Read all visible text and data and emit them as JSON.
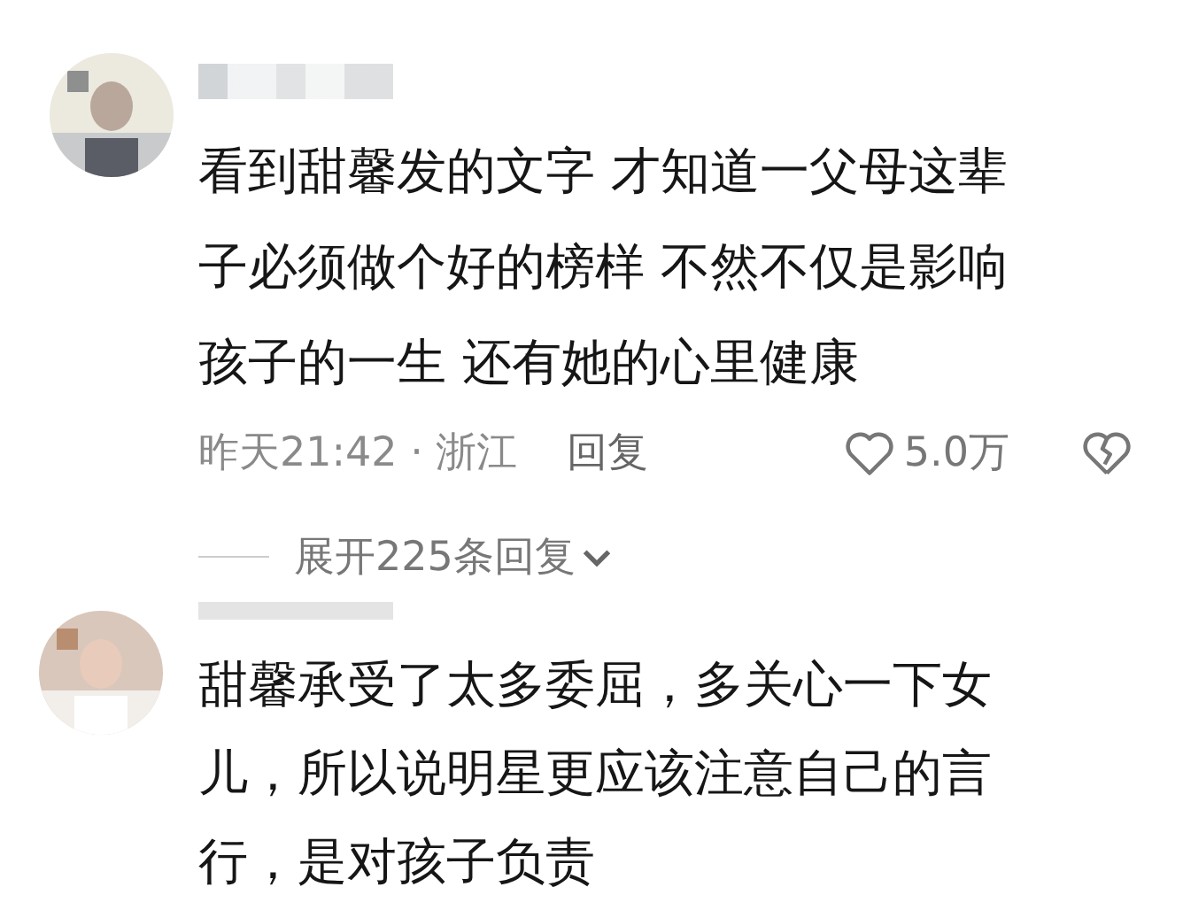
{
  "comments": [
    {
      "text_lines": [
        "看到甜馨发的文字 才知道一父母这辈",
        "子必须做个好的榜样 不然不仅是影响",
        "孩子的一生 还有她的心里健康"
      ],
      "time": "昨天21:42 · 浙江",
      "reply": "回复",
      "likes": "5.0万",
      "liked": false,
      "expand": "展开225条回复"
    },
    {
      "text_lines": [
        "甜馨承受了太多委屈，多关心一下女",
        "儿，所以说明星更应该注意自己的言",
        "行，是对孩子负责"
      ]
    }
  ]
}
